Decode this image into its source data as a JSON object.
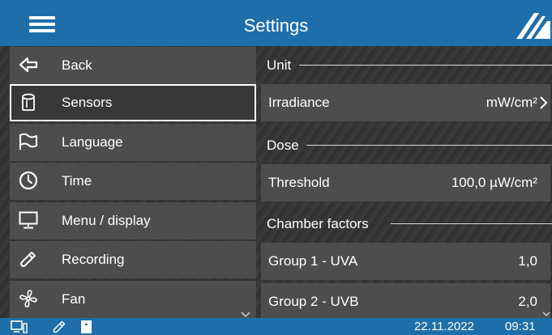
{
  "header": {
    "title": "Settings"
  },
  "sidebar": {
    "items": [
      {
        "label": "Back",
        "icon": "back-arrow-icon"
      },
      {
        "label": "Sensors",
        "icon": "sensor-icon",
        "selected": true
      },
      {
        "label": "Language",
        "icon": "flag-icon"
      },
      {
        "label": "Time",
        "icon": "clock-icon"
      },
      {
        "label": "Menu / display",
        "icon": "monitor-icon"
      },
      {
        "label": "Recording",
        "icon": "usb-stick-icon"
      },
      {
        "label": "Fan",
        "icon": "fan-icon"
      }
    ]
  },
  "panel": {
    "unit_section": "Unit",
    "irradiance": {
      "label": "Irradiance",
      "value": "mW/cm²"
    },
    "dose_section": "Dose",
    "threshold": {
      "label": "Threshold",
      "value": "100,0 µW/cm²"
    },
    "chamber_section": "Chamber factors",
    "group1": {
      "label": "Group 1 -  UVA",
      "value": "1,0"
    },
    "group2": {
      "label": "Group 2 - UVB",
      "value": "2,0"
    }
  },
  "statusbar": {
    "date": "22.11.2022",
    "time": "09:31"
  },
  "colors": {
    "header": "#1e6fa9",
    "item": "#4d4d4d",
    "background": "#2f2f2f"
  }
}
